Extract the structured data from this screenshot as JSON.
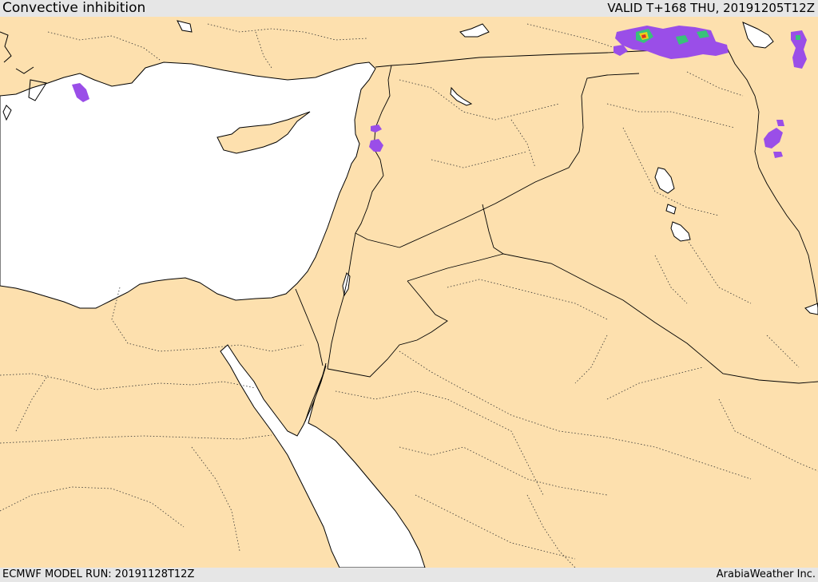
{
  "header": {
    "title": "Convective inhibition",
    "valid": "VALID T+168 THU, 20191205T12Z"
  },
  "footer": {
    "model_run": "ECMWF MODEL RUN: 20191128T12Z",
    "credit": "ArabiaWeather Inc."
  },
  "colors": {
    "land": "#fde0ae",
    "sea": "#ffffff",
    "bar": "#e6e6e6",
    "cin_low": "#9a4ee8",
    "cin_mid": "#38c27a",
    "cin_high": "#e8d21c",
    "cin_max": "#e03020"
  }
}
